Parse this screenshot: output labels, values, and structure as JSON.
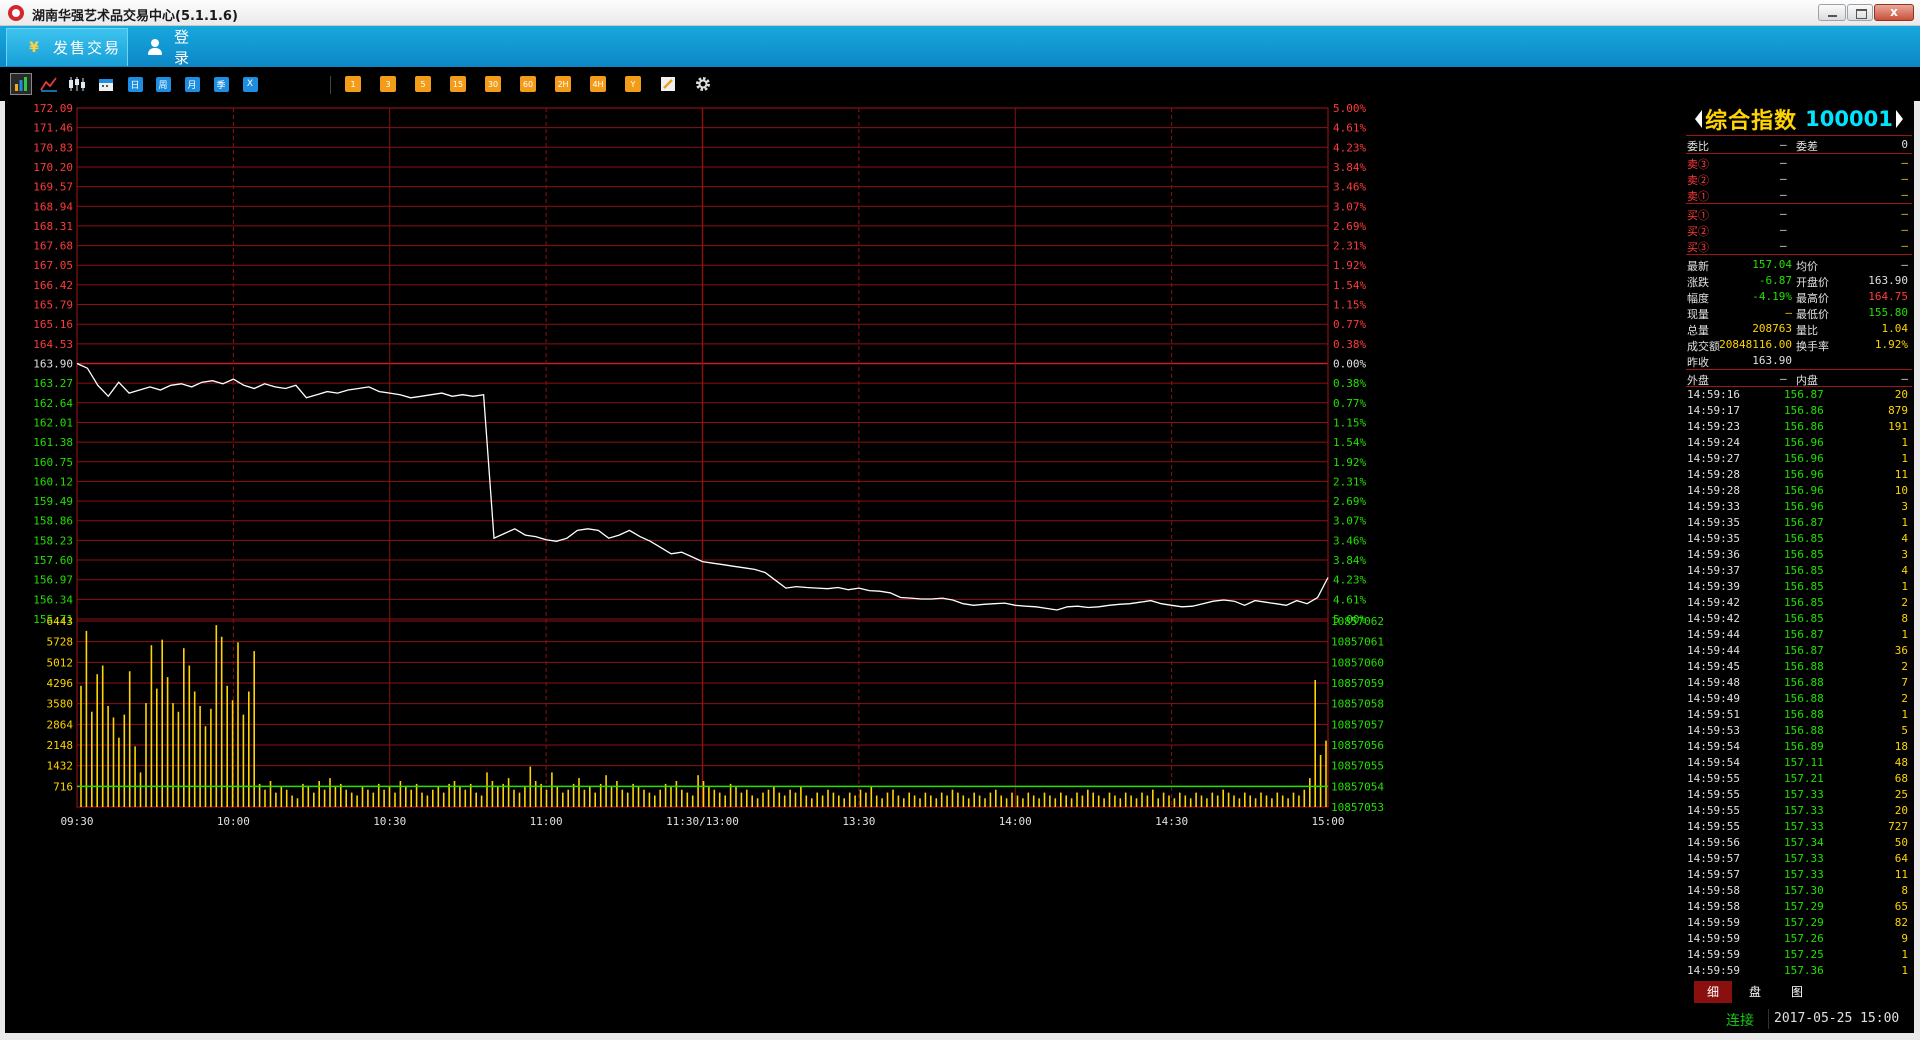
{
  "window": {
    "title": "湖南华强艺术品交易中心(5.1.1.6)",
    "close_label": "x"
  },
  "nav": {
    "trade_label": "发售交易",
    "trade_icon": "yuan-icon",
    "trade_icon_glyph": "¥",
    "login_label": "登 录"
  },
  "toolbar": {
    "period_buttons": [
      "1",
      "3",
      "5",
      "15",
      "30",
      "60",
      "2H",
      "4H",
      "Y"
    ],
    "day_buttons": [
      "日",
      "周",
      "月",
      "季",
      "X"
    ]
  },
  "colors": {
    "accent": "#0d87c6",
    "grid": "#8c1212",
    "price_up": "#ff3b3b",
    "price_down": "#22e000",
    "volume": "#ffd400",
    "volume_avg": "#22e000",
    "price_line": "#ffffff"
  },
  "chart_data": [
    {
      "type": "line",
      "name": "intraday-price",
      "x_ticks": [
        "09:30",
        "10:00",
        "10:30",
        "11:00",
        "11:30/13:00",
        "13:30",
        "14:00",
        "14:30",
        "15:00"
      ],
      "prev_close": 163.9,
      "ylim": [
        155.71,
        172.09
      ],
      "left_ticks_up": [
        "172.09",
        "171.46",
        "170.83",
        "170.20",
        "169.57",
        "168.94",
        "168.31",
        "167.68",
        "167.05",
        "166.42",
        "165.79",
        "165.16",
        "164.53"
      ],
      "left_tick_mid": "163.90",
      "left_ticks_down": [
        "163.27",
        "162.64",
        "162.01",
        "161.38",
        "160.75",
        "160.12",
        "159.49",
        "158.86",
        "158.23",
        "157.60",
        "156.97",
        "156.34",
        "155.71"
      ],
      "right_ticks_up": [
        "5.00%",
        "4.61%",
        "4.23%",
        "3.84%",
        "3.46%",
        "3.07%",
        "2.69%",
        "2.31%",
        "1.92%",
        "1.54%",
        "1.15%",
        "0.77%",
        "0.38%"
      ],
      "right_tick_mid": "0.00%",
      "right_ticks_down": [
        "0.38%",
        "0.77%",
        "1.15%",
        "1.54%",
        "1.92%",
        "2.31%",
        "2.69%",
        "3.07%",
        "3.46%",
        "3.84%",
        "4.23%",
        "4.61%",
        "5.00%"
      ],
      "series": [
        {
          "x": [
            0,
            2,
            4,
            6,
            8,
            10,
            12,
            14,
            16,
            18,
            20,
            22,
            24,
            26,
            28,
            30,
            32,
            34,
            36,
            38,
            40,
            42,
            44,
            46,
            48,
            50,
            52,
            54,
            56,
            58,
            60,
            62,
            64,
            66,
            68,
            70,
            72,
            74,
            76,
            78,
            80,
            82,
            84,
            86,
            88,
            90,
            92,
            94,
            96,
            98,
            100,
            102,
            104,
            106,
            108,
            110,
            112,
            114,
            116,
            118,
            120,
            122,
            124,
            126,
            128,
            130,
            132,
            134,
            136,
            138,
            140,
            142,
            144,
            146,
            148,
            150,
            152,
            154,
            156,
            158,
            160,
            162,
            164,
            166,
            168,
            170,
            172,
            174,
            176,
            178,
            180,
            182,
            184,
            186,
            188,
            190,
            192,
            194,
            196,
            198,
            200,
            202,
            204,
            206,
            208,
            210,
            212,
            214,
            216,
            218,
            220,
            222,
            224,
            226,
            228,
            230,
            232,
            234,
            236,
            238,
            240
          ],
          "values": [
            163.9,
            163.75,
            163.2,
            162.85,
            163.3,
            162.95,
            163.05,
            163.15,
            163.05,
            163.2,
            163.25,
            163.15,
            163.3,
            163.35,
            163.25,
            163.4,
            163.2,
            163.1,
            163.25,
            163.15,
            163.1,
            163.2,
            162.8,
            162.9,
            163.0,
            162.95,
            163.05,
            163.1,
            163.15,
            163.0,
            162.95,
            162.9,
            162.8,
            162.85,
            162.9,
            162.95,
            162.85,
            162.9,
            162.85,
            162.9,
            158.3,
            158.45,
            158.6,
            158.4,
            158.35,
            158.25,
            158.2,
            158.3,
            158.55,
            158.6,
            158.55,
            158.3,
            158.4,
            158.55,
            158.35,
            158.2,
            158.0,
            157.8,
            157.85,
            157.7,
            157.55,
            157.5,
            157.45,
            157.4,
            157.35,
            157.3,
            157.2,
            156.95,
            156.7,
            156.75,
            156.72,
            156.7,
            156.68,
            156.72,
            156.65,
            156.7,
            156.62,
            156.6,
            156.55,
            156.4,
            156.38,
            156.35,
            156.35,
            156.38,
            156.32,
            156.2,
            156.15,
            156.18,
            156.2,
            156.22,
            156.15,
            156.12,
            156.1,
            156.05,
            156.0,
            156.1,
            156.12,
            156.08,
            156.1,
            156.15,
            156.18,
            156.2,
            156.25,
            156.3,
            156.2,
            156.15,
            156.1,
            156.12,
            156.2,
            156.28,
            156.32,
            156.28,
            156.15,
            156.3,
            156.25,
            156.2,
            156.15,
            156.3,
            156.2,
            156.4,
            157.04
          ]
        }
      ]
    },
    {
      "type": "bar",
      "name": "intraday-volume",
      "left_ticks": [
        "6443",
        "5728",
        "5012",
        "4296",
        "3580",
        "2864",
        "2148",
        "1432",
        "716"
      ],
      "right_ticks": [
        "10857062",
        "10857061",
        "10857060",
        "10857059",
        "10857058",
        "10857057",
        "10857056",
        "10857055",
        "10857054",
        "10857053"
      ],
      "ylim": [
        0,
        6443
      ],
      "avg_level": 716,
      "values": [
        4200,
        6100,
        3300,
        4600,
        4900,
        3500,
        3100,
        2400,
        3200,
        4700,
        2100,
        1200,
        3600,
        5600,
        4100,
        5800,
        4500,
        3600,
        3300,
        5500,
        4900,
        4000,
        3500,
        2800,
        3400,
        6300,
        5900,
        4200,
        3700,
        5700,
        3200,
        4000,
        5400,
        800,
        600,
        900,
        500,
        700,
        600,
        400,
        300,
        800,
        700,
        500,
        900,
        600,
        1000,
        700,
        800,
        600,
        500,
        400,
        700,
        600,
        500,
        800,
        600,
        700,
        500,
        900,
        700,
        600,
        800,
        500,
        400,
        600,
        700,
        500,
        800,
        900,
        700,
        600,
        800,
        500,
        400,
        1200,
        900,
        700,
        800,
        1000,
        600,
        500,
        700,
        1400,
        900,
        800,
        600,
        1200,
        700,
        500,
        600,
        800,
        1000,
        600,
        700,
        500,
        800,
        1100,
        700,
        900,
        600,
        500,
        800,
        700,
        600,
        500,
        400,
        600,
        800,
        700,
        900,
        600,
        500,
        400,
        1100,
        900,
        700,
        600,
        500,
        400,
        800,
        700,
        500,
        600,
        400,
        300,
        500,
        600,
        700,
        500,
        400,
        600,
        500,
        700,
        400,
        300,
        500,
        400,
        600,
        500,
        400,
        300,
        500,
        400,
        600,
        500,
        700,
        400,
        300,
        500,
        600,
        400,
        300,
        500,
        400,
        300,
        500,
        400,
        300,
        500,
        400,
        600,
        500,
        400,
        300,
        500,
        400,
        300,
        500,
        600,
        400,
        300,
        500,
        400,
        300,
        500,
        400,
        300,
        500,
        400,
        300,
        500,
        400,
        300,
        500,
        400,
        600,
        500,
        400,
        300,
        500,
        400,
        300,
        500,
        400,
        300,
        500,
        400,
        600,
        300,
        500,
        400,
        300,
        500,
        400,
        300,
        500,
        400,
        300,
        500,
        400,
        600,
        500,
        400,
        300,
        500,
        400,
        300,
        500,
        400,
        300,
        500,
        400,
        300,
        500,
        400,
        600,
        1000,
        4400,
        1800,
        2300
      ]
    }
  ],
  "panel": {
    "name": "综合指数",
    "code": "100001",
    "ratio_label": "委比",
    "ratio_value": "—",
    "diff_label": "委差",
    "diff_value": "0",
    "sell": [
      {
        "label": "卖③",
        "price": "—",
        "vol": "—"
      },
      {
        "label": "卖②",
        "price": "—",
        "vol": "—"
      },
      {
        "label": "卖①",
        "price": "—",
        "vol": "—"
      }
    ],
    "buy": [
      {
        "label": "买①",
        "price": "—",
        "vol": "—"
      },
      {
        "label": "买②",
        "price": "—",
        "vol": "—"
      },
      {
        "label": "买③",
        "price": "—",
        "vol": "—"
      }
    ],
    "stats": [
      {
        "l1": "最新",
        "v1": "157.04",
        "c1": "c-grn",
        "l2": "均价",
        "v2": "—",
        "c2": "c-wht"
      },
      {
        "l1": "涨跌",
        "v1": "-6.87",
        "c1": "c-grn",
        "l2": "开盘价",
        "v2": "163.90",
        "c2": "c-wht"
      },
      {
        "l1": "幅度",
        "v1": "-4.19%",
        "c1": "c-grn",
        "l2": "最高价",
        "v2": "164.75",
        "c2": "c-red"
      },
      {
        "l1": "现量",
        "v1": "—",
        "c1": "c-yel",
        "l2": "最低价",
        "v2": "155.80",
        "c2": "c-grn"
      },
      {
        "l1": "总量",
        "v1": "208763",
        "c1": "c-yel",
        "l2": "量比",
        "v2": "1.04",
        "c2": "c-yel"
      },
      {
        "l1": "成交额",
        "v1": "20848116.00",
        "c1": "c-yel",
        "l2": "换手率",
        "v2": "1.92%",
        "c2": "c-yel"
      },
      {
        "l1": "昨收",
        "v1": "163.90",
        "c1": "c-wht",
        "l2": "",
        "v2": "",
        "c2": "c-wht"
      }
    ],
    "outer_label": "外盘",
    "outer_value": "—",
    "inner_label": "内盘",
    "inner_value": "—",
    "ticks": [
      {
        "t": "14:59:16",
        "p": "156.87",
        "v": "20"
      },
      {
        "t": "14:59:17",
        "p": "156.86",
        "v": "879"
      },
      {
        "t": "14:59:23",
        "p": "156.86",
        "v": "191"
      },
      {
        "t": "14:59:24",
        "p": "156.96",
        "v": "1"
      },
      {
        "t": "14:59:27",
        "p": "156.96",
        "v": "1"
      },
      {
        "t": "14:59:28",
        "p": "156.96",
        "v": "11"
      },
      {
        "t": "14:59:28",
        "p": "156.96",
        "v": "10"
      },
      {
        "t": "14:59:33",
        "p": "156.96",
        "v": "3"
      },
      {
        "t": "14:59:35",
        "p": "156.87",
        "v": "1"
      },
      {
        "t": "14:59:35",
        "p": "156.85",
        "v": "4"
      },
      {
        "t": "14:59:36",
        "p": "156.85",
        "v": "3"
      },
      {
        "t": "14:59:37",
        "p": "156.85",
        "v": "4"
      },
      {
        "t": "14:59:39",
        "p": "156.85",
        "v": "1"
      },
      {
        "t": "14:59:42",
        "p": "156.85",
        "v": "2"
      },
      {
        "t": "14:59:42",
        "p": "156.85",
        "v": "8"
      },
      {
        "t": "14:59:44",
        "p": "156.87",
        "v": "1"
      },
      {
        "t": "14:59:44",
        "p": "156.87",
        "v": "36"
      },
      {
        "t": "14:59:45",
        "p": "156.88",
        "v": "2"
      },
      {
        "t": "14:59:48",
        "p": "156.88",
        "v": "7"
      },
      {
        "t": "14:59:49",
        "p": "156.88",
        "v": "2"
      },
      {
        "t": "14:59:51",
        "p": "156.88",
        "v": "1"
      },
      {
        "t": "14:59:53",
        "p": "156.88",
        "v": "5"
      },
      {
        "t": "14:59:54",
        "p": "156.89",
        "v": "18"
      },
      {
        "t": "14:59:54",
        "p": "157.11",
        "v": "48"
      },
      {
        "t": "14:59:55",
        "p": "157.21",
        "v": "68"
      },
      {
        "t": "14:59:55",
        "p": "157.33",
        "v": "25"
      },
      {
        "t": "14:59:55",
        "p": "157.33",
        "v": "20"
      },
      {
        "t": "14:59:55",
        "p": "157.33",
        "v": "727"
      },
      {
        "t": "14:59:56",
        "p": "157.34",
        "v": "50"
      },
      {
        "t": "14:59:57",
        "p": "157.33",
        "v": "64"
      },
      {
        "t": "14:59:57",
        "p": "157.33",
        "v": "11"
      },
      {
        "t": "14:59:58",
        "p": "157.30",
        "v": "8"
      },
      {
        "t": "14:59:58",
        "p": "157.29",
        "v": "65"
      },
      {
        "t": "14:59:59",
        "p": "157.29",
        "v": "82"
      },
      {
        "t": "14:59:59",
        "p": "157.26",
        "v": "9"
      },
      {
        "t": "14:59:59",
        "p": "157.25",
        "v": "1"
      },
      {
        "t": "14:59:59",
        "p": "157.36",
        "v": "1"
      }
    ],
    "tabs": [
      "细",
      "盘",
      "图"
    ],
    "selected_tab": 0
  },
  "status": {
    "connection": "连接",
    "datetime": "2017-05-25 15:00"
  }
}
